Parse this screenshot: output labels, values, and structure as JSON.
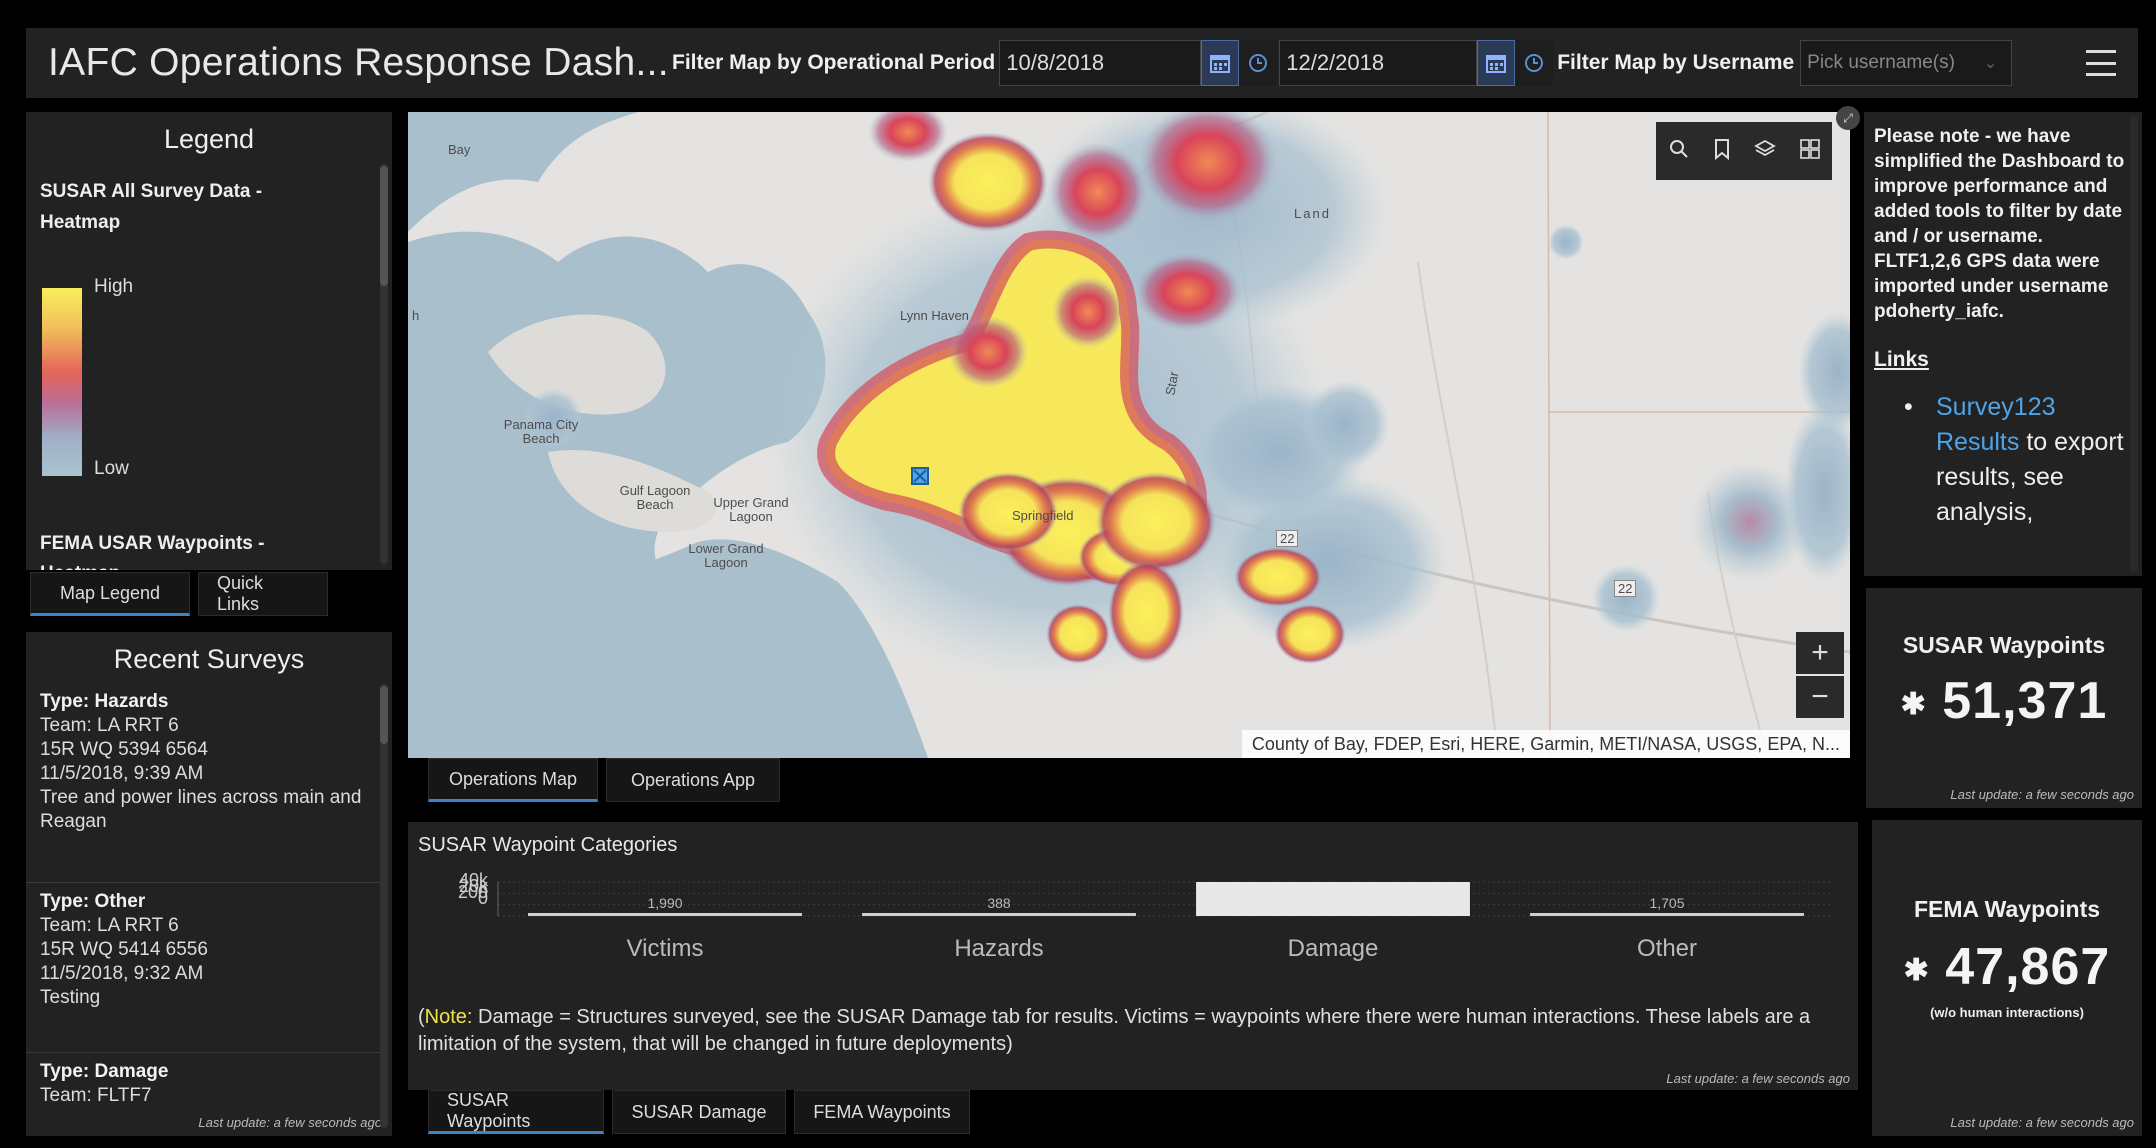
{
  "header": {
    "title": "IAFC Operations Response Dash...",
    "filter_period_label": "Filter Map by Operational Period",
    "start_date": "10/8/2018",
    "end_date": "12/2/2018",
    "filter_user_label": "Filter Map by Username",
    "user_placeholder": "Pick username(s)"
  },
  "legend": {
    "title": "Legend",
    "layer1": "SUSAR All Survey Data - Heatmap",
    "high": "High",
    "low": "Low",
    "layer2": "FEMA USAR Waypoints -",
    "layer2_cut": "Heatmap",
    "tabs": [
      "Map Legend",
      "Quick Links"
    ]
  },
  "surveys": {
    "title": "Recent Surveys",
    "items": [
      {
        "type": "Type: Hazards",
        "team": "Team: LA RRT 6",
        "grid": "15R WQ 5394 6564",
        "time": "11/5/2018, 9:39 AM",
        "desc": "Tree and power lines across main and Reagan"
      },
      {
        "type": "Type: Other",
        "team": "Team: LA RRT 6",
        "grid": "15R WQ 5414 6556",
        "time": "11/5/2018, 9:32 AM",
        "desc": "Testing"
      },
      {
        "type": "Type: Damage",
        "team": "Team: FLTF7",
        "grid": "",
        "time": "",
        "desc": ""
      }
    ],
    "last_update": "Last update: a few seconds ago"
  },
  "map": {
    "attribution": "County of Bay, FDEP, Esri, HERE, Garmin, METI/NASA, USGS, EPA, N...",
    "labels": {
      "bay": "Bay",
      "land": "Land",
      "panama": "Panama City Beach",
      "gulf_lagoon": "Gulf Lagoon Beach",
      "upper_grand": "Upper Grand Lagoon",
      "lower_grand": "Lower Grand Lagoon",
      "lynn_haven": "Lynn Haven",
      "springfield": "Springfield",
      "star": "Star",
      "hwy_22": "22",
      "hwy_22b": "22",
      "h": "h",
      "tabs": [
        "Operations Map",
        "Operations App"
      ]
    },
    "zoom_in": "+",
    "zoom_out": "−"
  },
  "notes": {
    "text": "Please note - we have simplified the Dashboard to improve performance and added tools to filter by date and / or username. FLTF1,2,6 GPS data were imported under username pdoherty_iafc.",
    "links_header": "Links",
    "link_text": "Survey123 Results",
    "link_rest": " to export results, see analysis,"
  },
  "kpi_susar": {
    "title": "SUSAR Waypoints",
    "value": "51,371",
    "last_update": "Last update: a few seconds ago"
  },
  "kpi_fema": {
    "title": "FEMA Waypoints",
    "value": "47,867",
    "sub": "(w/o human interactions)",
    "last_update": "Last update: a few seconds ago"
  },
  "categories": {
    "title": "SUSAR Waypoint Categories",
    "note_label": "Note:",
    "note_text": " Damage = Structures surveyed, see the SUSAR Damage tab for results. Victims = waypoints where there were human interactions. These labels are a limitation of the system, that will be changed in future deployments)",
    "note_open": "(",
    "last_update": "Last update: a few seconds ago",
    "tabs": [
      "SUSAR Waypoints",
      "SUSAR Damage",
      "FEMA Waypoints"
    ]
  },
  "chart_data": {
    "type": "bar",
    "title": "SUSAR Waypoint Categories",
    "categories": [
      "Victims",
      "Hazards",
      "Damage",
      "Other"
    ],
    "values": [
      1990,
      388,
      47288,
      1705
    ],
    "data_labels": [
      "1,990",
      "388",
      "",
      "1,705"
    ],
    "y_tick_labels": [
      "40k",
      "20k",
      "200",
      "0"
    ],
    "ylim": [
      0,
      47288
    ],
    "grid": true,
    "colors": {
      "bar": "#e8e8e8",
      "bar_small": "#cfcfcf"
    }
  },
  "colors": {
    "background": "#000000",
    "panel": "#222222",
    "accent": "#3d84c6",
    "link": "#4fa3e6",
    "note": "#f0e24a"
  }
}
